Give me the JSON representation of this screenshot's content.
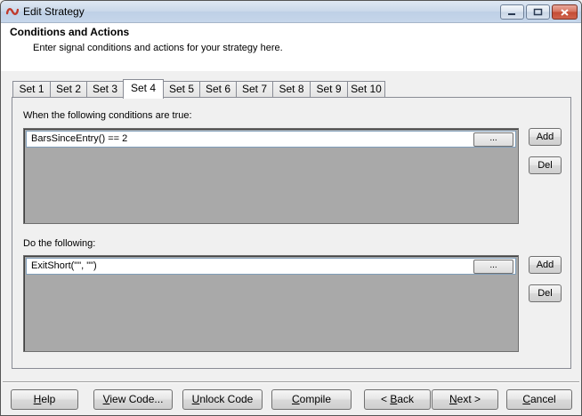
{
  "window": {
    "title": "Edit Strategy",
    "icons": {
      "app": "app-logo-icon",
      "minimize": "minimize-icon",
      "maximize": "maximize-icon",
      "close": "close-icon"
    }
  },
  "header": {
    "title": "Conditions and Actions",
    "subtitle": "Enter signal conditions and actions for your strategy here."
  },
  "tabs": [
    {
      "label": "Set 1"
    },
    {
      "label": "Set 2"
    },
    {
      "label": "Set 3"
    },
    {
      "label": "Set 4",
      "active": true
    },
    {
      "label": "Set 5"
    },
    {
      "label": "Set 6"
    },
    {
      "label": "Set 7"
    },
    {
      "label": "Set 8"
    },
    {
      "label": "Set 9"
    },
    {
      "label": "Set 10"
    }
  ],
  "conditions": {
    "label": "When the following conditions are true:",
    "items": [
      "BarsSinceEntry() == 2"
    ],
    "ellipsis_label": "...",
    "add_label": "Add",
    "del_label": "Del"
  },
  "actions": {
    "label": "Do the following:",
    "items": [
      "ExitShort(\"\", \"\")"
    ],
    "ellipsis_label": "...",
    "add_label": "Add",
    "del_label": "Del"
  },
  "footer": {
    "help": {
      "pre": "",
      "key": "H",
      "post": "elp"
    },
    "view_code": {
      "pre": "",
      "key": "V",
      "post": "iew Code..."
    },
    "unlock_code": {
      "pre": "",
      "key": "U",
      "post": "nlock Code"
    },
    "compile": {
      "pre": "",
      "key": "C",
      "post": "ompile"
    },
    "back": {
      "pre": "< ",
      "key": "B",
      "post": "ack"
    },
    "next": {
      "pre": "",
      "key": "N",
      "post": "ext >"
    },
    "cancel": {
      "pre": "",
      "key": "C",
      "post": "ancel"
    }
  },
  "colors": {
    "accent": "#c0392b",
    "list_background": "#a9a9a9",
    "window_background": "#f0f0f0"
  }
}
